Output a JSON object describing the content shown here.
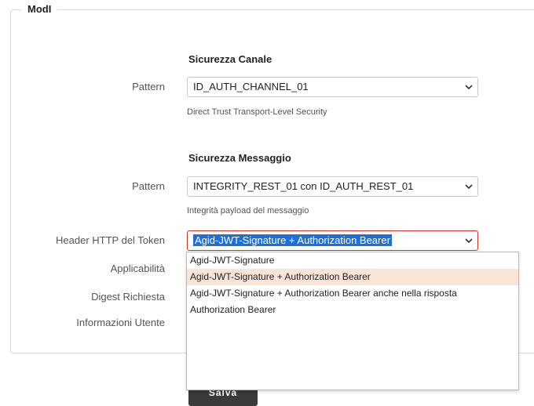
{
  "fieldset": {
    "legend": "ModI"
  },
  "channel": {
    "title": "Sicurezza Canale",
    "pattern_label": "Pattern",
    "pattern_value": "ID_AUTH_CHANNEL_01",
    "hint": "Direct Trust Transport-Level Security"
  },
  "message": {
    "title": "Sicurezza Messaggio",
    "pattern_label": "Pattern",
    "pattern_value": "INTEGRITY_REST_01 con ID_AUTH_REST_01",
    "hint": "Integrità payload del messaggio",
    "header_label": "Header HTTP del Token",
    "header_value": "Agid-JWT-Signature + Authorization Bearer",
    "applicability_label": "Applicabilità",
    "digest_label": "Digest Richiesta",
    "user_info_label": "Informazioni Utente"
  },
  "dropdown": {
    "options": [
      "Agid-JWT-Signature",
      "Agid-JWT-Signature + Authorization Bearer",
      "Agid-JWT-Signature + Authorization Bearer anche nella risposta",
      "Authorization Bearer"
    ],
    "highlighted_index": 1
  },
  "footer": {
    "submit_label": "Salva"
  },
  "colors": {
    "accent": "#c9342a",
    "highlight": "#f9e5d8",
    "selection": "#1f6fd8"
  },
  "icons": {
    "select_arrow": "chevron-down-icon"
  }
}
